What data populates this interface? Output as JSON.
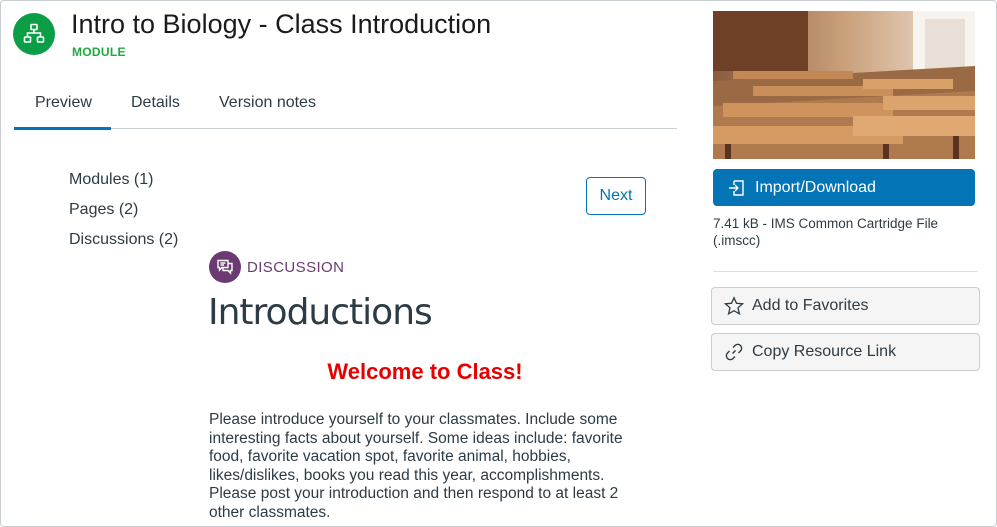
{
  "header": {
    "title": "Intro to Biology - Class Introduction",
    "type_label": "MODULE",
    "icon": "module-icon"
  },
  "tabs": [
    {
      "label": "Preview",
      "active": true
    },
    {
      "label": "Details",
      "active": false
    },
    {
      "label": "Version notes",
      "active": false
    }
  ],
  "nav": [
    {
      "label": "Modules (1)"
    },
    {
      "label": "Pages (2)"
    },
    {
      "label": "Discussions (2)"
    }
  ],
  "pager": {
    "next_label": "Next"
  },
  "content": {
    "item_type": "DISCUSSION",
    "item_icon": "discussion-icon",
    "title": "Introductions",
    "heading": "Welcome to Class!",
    "body": "Please introduce yourself to your classmates. Include some interesting facts about yourself. Some ideas include: favorite food, favorite vacation spot, favorite animal, hobbies, likes/dislikes, books you read this year, accomplishments. Please post your introduction and then respond to at least 2 other classmates."
  },
  "sidebar": {
    "import_label": "Import/Download",
    "import_icon": "import-icon",
    "file_info": "7.41 kB - IMS Common Cartridge File (.imscc)",
    "favorite_label": "Add to Favorites",
    "favorite_icon": "star-icon",
    "copy_link_label": "Copy Resource Link",
    "copy_link_icon": "link-icon"
  },
  "colors": {
    "module_green": "#0b9e47",
    "brand_blue": "#0374b5",
    "discussion_purple": "#6b3a73",
    "welcome_red": "#e60000"
  }
}
